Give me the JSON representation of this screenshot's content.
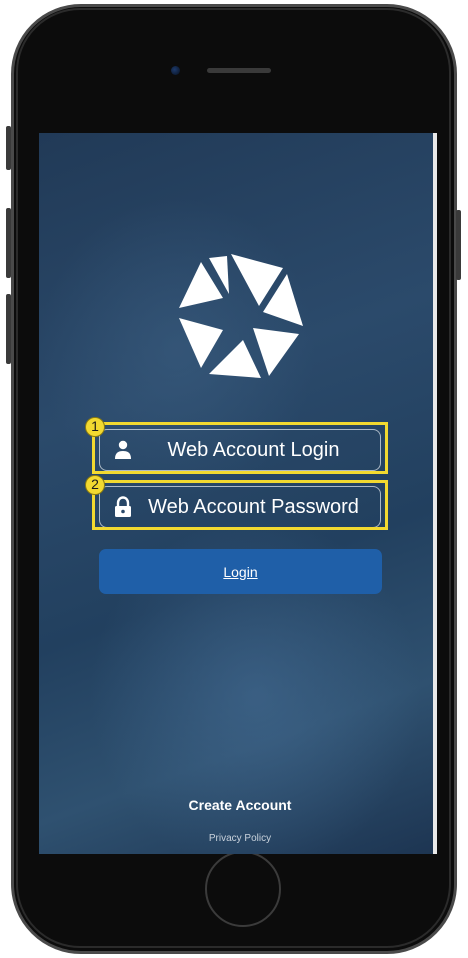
{
  "app": {
    "logo_name": "aperture-logo"
  },
  "login_form": {
    "username_field": {
      "placeholder": "Web Account Login",
      "icon": "user-icon"
    },
    "password_field": {
      "placeholder": "Web Account Password",
      "icon": "lock-icon"
    },
    "login_button_label": "Login"
  },
  "footer": {
    "create_account_label": "Create Account",
    "privacy_policy_label": "Privacy Policy"
  },
  "annotations": {
    "marker_1": "1",
    "marker_2": "2",
    "highlight_color": "#f2d930"
  },
  "colors": {
    "login_button": "#1f5fa8",
    "screen_background": "#2b4a6b"
  }
}
